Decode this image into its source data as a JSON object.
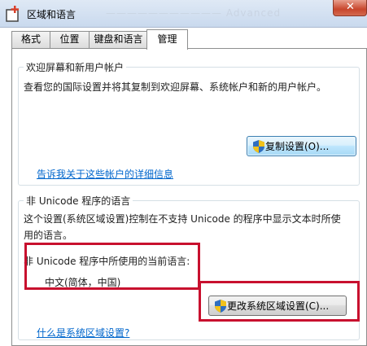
{
  "window": {
    "title": "区域和语言",
    "ghost_title": "——————————— Advanced",
    "close_symbol": "✕"
  },
  "tabs": [
    {
      "label": "格式",
      "active": false
    },
    {
      "label": "位置",
      "active": false
    },
    {
      "label": "键盘和语言",
      "active": false
    },
    {
      "label": "管理",
      "active": true
    }
  ],
  "welcome": {
    "group_title": "欢迎屏幕和新用户帐户",
    "description": "查看您的国际设置并将其复制到欢迎屏幕、系统帐户和新的用户帐户。",
    "copy_button": "复制设置(O)...",
    "link": "告诉我关于这些帐户的详细信息"
  },
  "non_unicode": {
    "group_title": "非 Unicode 程序的语言",
    "description_line1": "这个设置(系统区域设置)控制在不支持 Unicode 的程序中显示文本时所使",
    "description_line2": "用的语言。",
    "current_label": "非 Unicode 程序中所使用的当前语言:",
    "current_value": "中文(简体，中国)",
    "change_button": "更改系统区域设置(C)...",
    "link": "什么是系统区域设置?"
  },
  "colors": {
    "highlight_border": "#c8102e",
    "link": "#0066cc"
  },
  "icons": {
    "app": "region-globe-icon",
    "shield": "uac-shield-icon"
  }
}
